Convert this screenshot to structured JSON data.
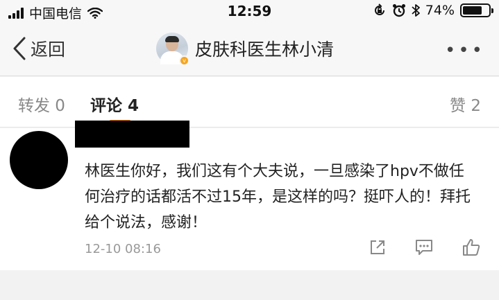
{
  "status_bar": {
    "carrier": "中国电信",
    "time": "12:59",
    "battery_text": "74%",
    "battery_level": 0.74,
    "icons": [
      "signal-icon",
      "wifi-icon",
      "rotation-lock-icon",
      "alarm-icon",
      "bluetooth-icon",
      "battery-icon"
    ]
  },
  "nav": {
    "back_label": "返回",
    "title": "皮肤科医生林小清",
    "more_label": "•••",
    "verified_mark": "v"
  },
  "tabs": [
    {
      "label": "转发 0",
      "active": false
    },
    {
      "label": "评论 4",
      "active": true
    },
    {
      "label": "赞 2",
      "active": false
    }
  ],
  "comment": {
    "text": "林医生你好，我们这有个大夫说，一旦感染了hpv不做任何治疗的话都活不过15年，是这样的吗？挺吓人的！拜托给个说法，感谢！",
    "time": "12-10 08:16",
    "actions": [
      "share-icon",
      "reply-icon",
      "like-icon"
    ]
  },
  "colors": {
    "accent": "#ff8200",
    "verified": "#f5a623",
    "muted_text": "#999999"
  }
}
